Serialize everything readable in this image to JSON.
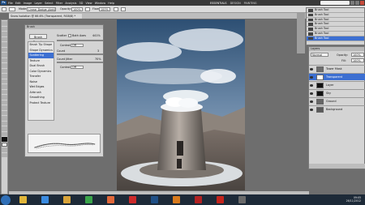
{
  "app": {
    "logo": "Ps"
  },
  "menu": [
    "File",
    "Edit",
    "Image",
    "Layer",
    "Select",
    "Filter",
    "Analysis",
    "3D",
    "View",
    "Window",
    "Help"
  ],
  "workspaces": [
    "ESSENTIALS",
    "DESIGN",
    "PAINTING"
  ],
  "options_bar": {
    "mode_label": "Mode:",
    "mode_value": "Linear Dodge (Add)",
    "opacity_label": "Opacity:",
    "opacity_value": "100%",
    "flow_label": "Flow:",
    "flow_value": "100%"
  },
  "document": {
    "tab_title": "Snow Isolation @ 66.6% (Transparent, RGB/8) *"
  },
  "brush_panel": {
    "title": "Brush",
    "presets_button": "Brush Presets",
    "list": [
      "Brush Tip Shape",
      "Shape Dynamics",
      "Scattering",
      "Texture",
      "Dual Brush",
      "Color Dynamics",
      "Transfer",
      "Noise",
      "Wet Edges",
      "Airbrush",
      "Smoothing",
      "Protect Texture"
    ],
    "selected_index": 2,
    "scatter_label": "Scatter",
    "both_axes_label": "Both Axes",
    "scatter_value": "441%",
    "control_label": "Control:",
    "control_value": "Off",
    "count_label": "Count",
    "count_value": "3",
    "count_jitter_label": "Count Jitter",
    "count_jitter_value": "70%",
    "control2_value": "Off"
  },
  "brush_swatches": {
    "items": [
      "Brush Tool",
      "Brush Tool",
      "Brush Tool",
      "Brush Tool",
      "Brush Tool",
      "Brush Tool",
      "Brush Tool"
    ],
    "selected_index": 6
  },
  "layers_panel": {
    "title": "Layers",
    "blend_value": "Normal",
    "opacity_label": "Opacity:",
    "opacity_value": "100%",
    "fill_label": "Fill:",
    "fill_value": "100%",
    "layers": [
      {
        "name": "Tower Mask",
        "thumb": "#6d6d6d"
      },
      {
        "name": "Transparent",
        "thumb": "#ffffff"
      },
      {
        "name": "Layer",
        "thumb": "#111111"
      },
      {
        "name": "Sky",
        "thumb": "#111111"
      },
      {
        "name": "Ground",
        "thumb": "#666666"
      },
      {
        "name": "Background",
        "thumb": "#5a5a5a"
      }
    ],
    "selected_index": 1
  },
  "taskbar": {
    "icons": [
      {
        "name": "explorer-icon",
        "color": "#e1b63a"
      },
      {
        "name": "media-icon",
        "color": "#3a8be1"
      },
      {
        "name": "folder-icon",
        "color": "#d9a43a"
      },
      {
        "name": "chrome-icon",
        "color": "#3aa54a"
      },
      {
        "name": "firefox-icon",
        "color": "#e1683a"
      },
      {
        "name": "opera-icon",
        "color": "#cc2a2a"
      },
      {
        "name": "photoshop-icon",
        "color": "#1f4f86"
      },
      {
        "name": "illustrator-icon",
        "color": "#d87a1c"
      },
      {
        "name": "filezilla-icon",
        "color": "#b22222"
      },
      {
        "name": "acrobat-icon",
        "color": "#c4241c"
      },
      {
        "name": "app-icon",
        "color": "#6a6a6a"
      }
    ],
    "time": "09:05",
    "date": "26/11/2012"
  }
}
